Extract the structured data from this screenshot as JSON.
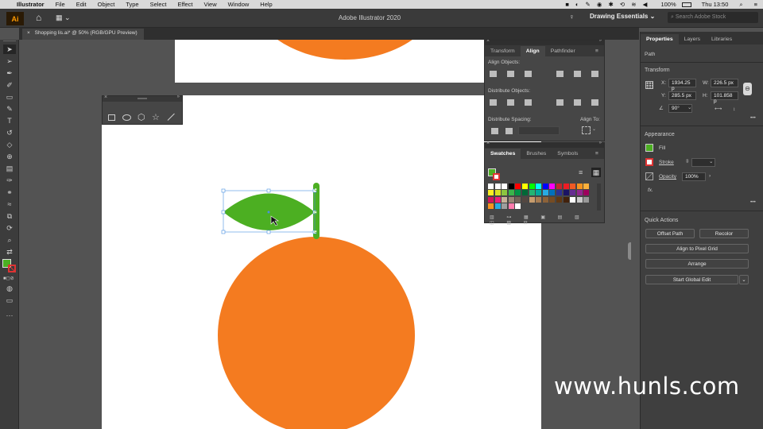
{
  "menubar": {
    "apple": "",
    "app": "Illustrator",
    "items": [
      "File",
      "Edit",
      "Object",
      "Type",
      "Select",
      "Effect",
      "View",
      "Window",
      "Help"
    ],
    "battery": "100%",
    "clock": "Thu 13:50"
  },
  "appbar": {
    "title": "Adobe Illustrator 2020",
    "workspace": "Drawing Essentials",
    "search_placeholder": "Search Adobe Stock"
  },
  "doc_tab": {
    "close": "×",
    "label": "Shopping lis.ai* @ 50% (RGB/GPU Preview)"
  },
  "align_panel": {
    "tabs": [
      "Transform",
      "Align",
      "Pathfinder"
    ],
    "align_objects": "Align Objects:",
    "distribute_objects": "Distribute Objects:",
    "distribute_spacing": "Distribute Spacing:",
    "align_to": "Align To:"
  },
  "swatches_panel": {
    "tabs": [
      "Swatches",
      "Brushes",
      "Symbols"
    ]
  },
  "properties": {
    "tabs": [
      "Properties",
      "Layers",
      "Libraries"
    ],
    "type": "Path",
    "transform_title": "Transform",
    "x_label": "X:",
    "x": "1934.25 p",
    "y_label": "Y:",
    "y": "285.5 px",
    "w_label": "W:",
    "w": "226.5 px",
    "h_label": "H:",
    "h": "101.858 p",
    "angle": "90°",
    "appearance_title": "Appearance",
    "fill": "Fill",
    "stroke": "Stroke",
    "opacity": "Opacity",
    "opacity_value": "100%",
    "fx": "fx.",
    "quick_actions_title": "Quick Actions",
    "offset_path": "Offset Path",
    "recolor": "Recolor",
    "align_pixel": "Align to Pixel Grid",
    "arrange": "Arrange",
    "global_edit": "Start Global Edit"
  },
  "colors": {
    "orange": "#f47b20",
    "leaf_green": "#4caf22",
    "selection": "#4a90e2"
  },
  "watermark": "www.hunls.com"
}
